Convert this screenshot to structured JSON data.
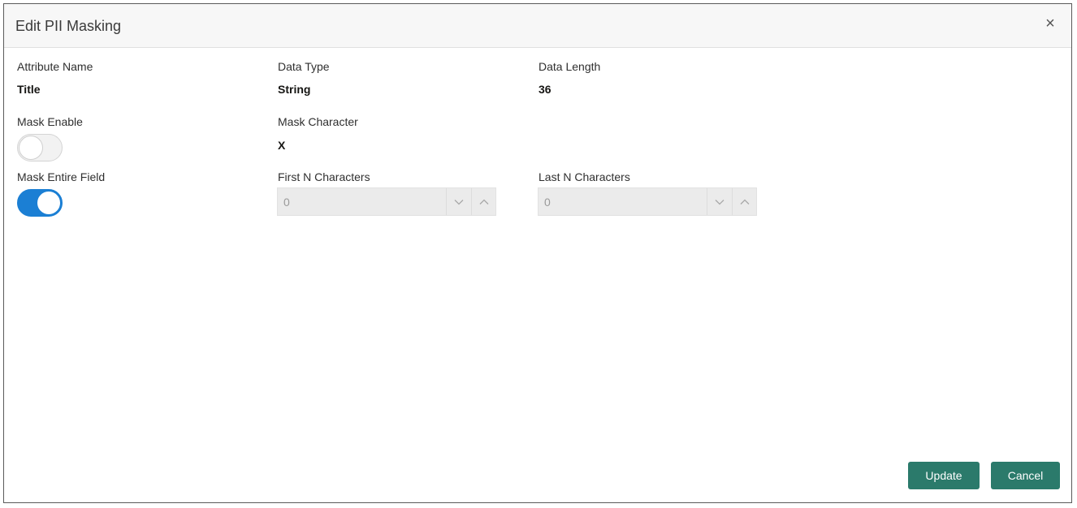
{
  "dialog": {
    "title": "Edit PII Masking",
    "close_icon": "close-icon",
    "close_glyph": "×"
  },
  "fields": {
    "attribute_name": {
      "label": "Attribute Name",
      "value": "Title"
    },
    "data_type": {
      "label": "Data Type",
      "value": "String"
    },
    "data_length": {
      "label": "Data Length",
      "value": "36"
    },
    "mask_enable": {
      "label": "Mask Enable",
      "enabled": false
    },
    "mask_character": {
      "label": "Mask Character",
      "value": "X"
    },
    "mask_entire_field": {
      "label": "Mask Entire Field",
      "enabled": true
    },
    "first_n_characters": {
      "label": "First N Characters",
      "value": "0",
      "disabled": true
    },
    "last_n_characters": {
      "label": "Last N Characters",
      "value": "0",
      "disabled": true
    }
  },
  "buttons": {
    "update": "Update",
    "cancel": "Cancel"
  },
  "colors": {
    "primary_button": "#2b7a6b",
    "toggle_on": "#1b7fd4",
    "disabled_field": "#ebebeb"
  }
}
